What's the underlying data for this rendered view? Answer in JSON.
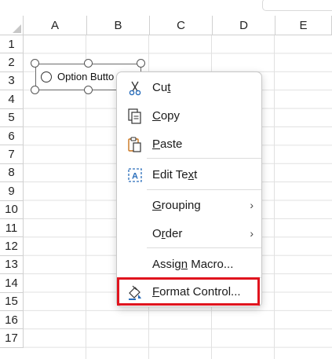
{
  "columns": [
    "A",
    "B",
    "C",
    "D",
    "E"
  ],
  "rows": [
    "1",
    "2",
    "3",
    "4",
    "5",
    "6",
    "7",
    "8",
    "9",
    "10",
    "11",
    "12",
    "13",
    "14",
    "15",
    "16",
    "17"
  ],
  "option_button": {
    "label": "Option Butto"
  },
  "context_menu": {
    "cut": {
      "prefix": "Cu",
      "accel": "t",
      "suffix": "",
      "icon": "scissors-icon"
    },
    "copy": {
      "prefix": "",
      "accel": "C",
      "suffix": "opy",
      "icon": "copy-icon"
    },
    "paste": {
      "prefix": "",
      "accel": "P",
      "suffix": "aste",
      "icon": "paste-icon"
    },
    "edit_text": {
      "prefix": "Edit Te",
      "accel": "x",
      "suffix": "t",
      "icon": "edit-text-icon"
    },
    "grouping": {
      "prefix": "",
      "accel": "G",
      "suffix": "rouping",
      "submenu": "›"
    },
    "order": {
      "prefix": "O",
      "accel": "r",
      "suffix": "der",
      "submenu": "›"
    },
    "assign_macro": {
      "prefix": "Assig",
      "accel": "n",
      "suffix": " Macro...",
      "icon": ""
    },
    "format_control": {
      "prefix": "",
      "accel": "F",
      "suffix": "ormat Control...",
      "icon": "format-control-icon"
    }
  },
  "highlight_color": "#e0141e"
}
